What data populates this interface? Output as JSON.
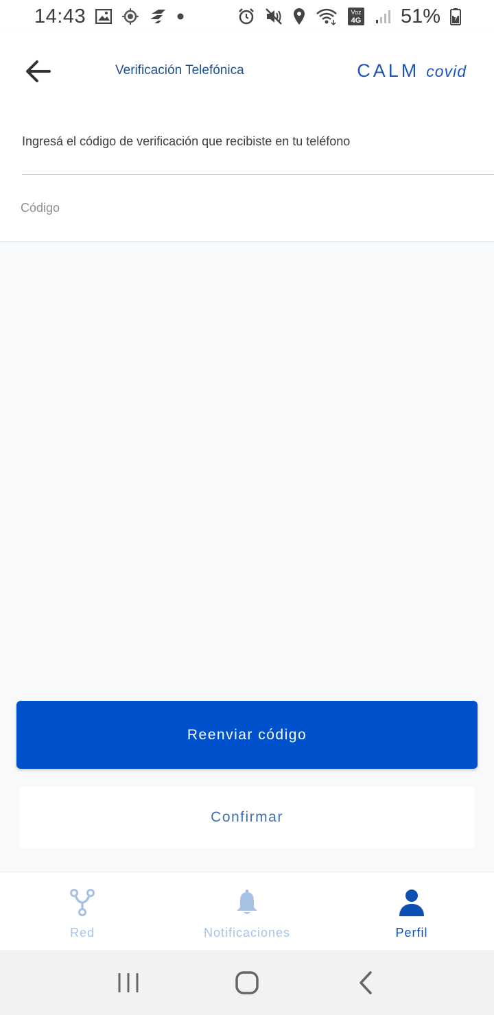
{
  "status_bar": {
    "time": "14:43",
    "battery_percent": "51%",
    "left_icons": [
      "image-icon",
      "location-target-icon",
      "app-notification-icon",
      "dot-icon"
    ],
    "right_icons": [
      "alarm-icon",
      "mute-icon",
      "location-pin-icon",
      "wifi-icon",
      "volte-4g-icon",
      "signal-icon",
      "battery-icon"
    ],
    "volte_label": "Voz",
    "network_label": "4G"
  },
  "header": {
    "title": "Verificación Telefónica",
    "brand_main": "CALM",
    "brand_sub": "covid"
  },
  "form": {
    "instruction": "Ingresá el código de verificación que recibiste en tu teléfono",
    "code_placeholder": "Código",
    "code_value": ""
  },
  "buttons": {
    "resend_label": "Reenviar código",
    "confirm_label": "Confirmar"
  },
  "bottom_nav": {
    "items": [
      {
        "label": "Red",
        "icon": "network-icon",
        "active": false
      },
      {
        "label": "Notificaciones",
        "icon": "bell-icon",
        "active": false
      },
      {
        "label": "Perfil",
        "icon": "person-icon",
        "active": true
      }
    ]
  },
  "colors": {
    "primary": "#0052cc",
    "brand": "#1d57b3",
    "nav_active": "#0d4fb3",
    "nav_inactive": "#a8c2e6"
  }
}
